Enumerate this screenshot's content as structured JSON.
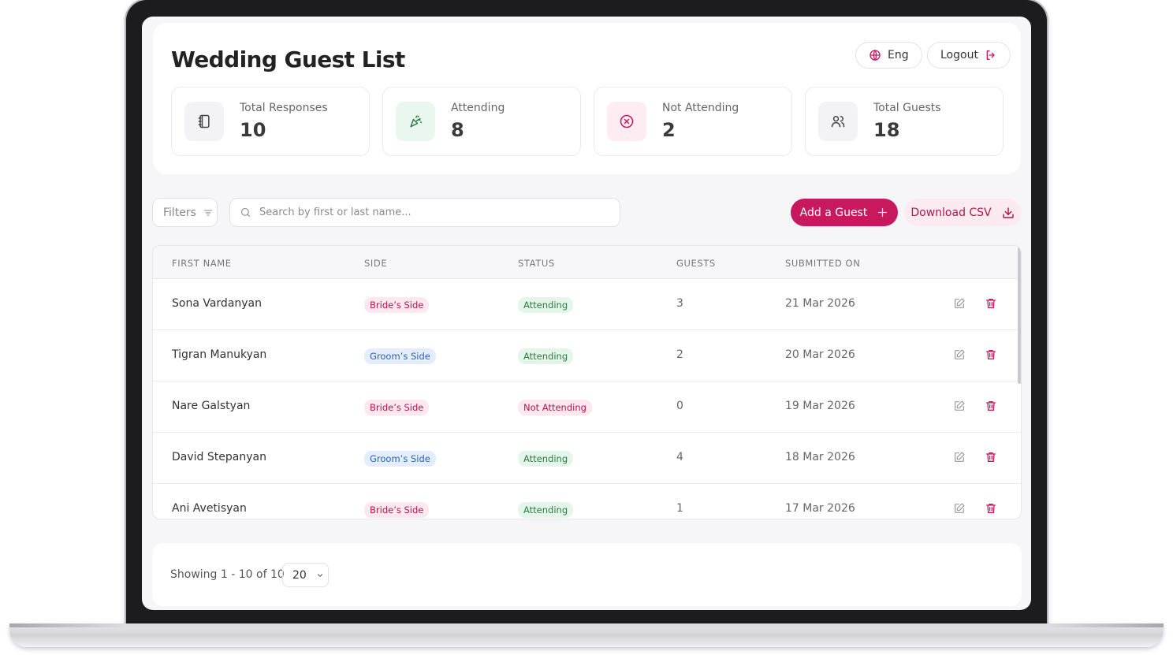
{
  "app": {
    "title": "Wedding Guest List",
    "lang_label": "Eng",
    "logout_label": "Logout"
  },
  "stats": [
    {
      "label": "Total Responses",
      "value": "10",
      "icon": "notebook-icon",
      "bg": "#f3f3f5",
      "color": "#444444"
    },
    {
      "label": "Attending",
      "value": "8",
      "icon": "party-popper-icon",
      "bg": "#eaf7ee",
      "color": "#2f7a45"
    },
    {
      "label": "Not Attending",
      "value": "2",
      "icon": "x-circle-icon",
      "bg": "#fdecf1",
      "color": "#c8185e"
    },
    {
      "label": "Total Guests",
      "value": "18",
      "icon": "users-icon",
      "bg": "#f3f3f5",
      "color": "#444444"
    }
  ],
  "toolbar": {
    "filters_label": "Filters",
    "search_placeholder": "Search by first or last name...",
    "add_label": "Add a Guest",
    "csv_label": "Download CSV"
  },
  "table": {
    "headers": [
      "FIRST NAME",
      "SIDE",
      "STATUS",
      "GUESTS",
      "SUBMITTED ON"
    ],
    "rows": [
      {
        "name": "Sona Vardanyan",
        "side": "Bride’s Side",
        "side_type": "bride",
        "status": "Attending",
        "status_type": "att",
        "guests": "3",
        "date": "21 Mar 2026"
      },
      {
        "name": "Tigran Manukyan",
        "side": "Groom’s Side",
        "side_type": "groom",
        "status": "Attending",
        "status_type": "att",
        "guests": "2",
        "date": "20 Mar 2026"
      },
      {
        "name": "Nare Galstyan",
        "side": "Bride’s Side",
        "side_type": "bride",
        "status": "Not Attending",
        "status_type": "not",
        "guests": "0",
        "date": "19 Mar 2026"
      },
      {
        "name": "David Stepanyan",
        "side": "Groom’s Side",
        "side_type": "groom",
        "status": "Attending",
        "status_type": "att",
        "guests": "4",
        "date": "18 Mar 2026"
      },
      {
        "name": "Ani Avetisyan",
        "side": "Bride’s Side",
        "side_type": "bride",
        "status": "Attending",
        "status_type": "att",
        "guests": "1",
        "date": "17 Mar 2026"
      }
    ]
  },
  "footer": {
    "showing_label": "Showing 1 - 10 of 10",
    "page_size": "20"
  },
  "colors": {
    "accent": "#c8185e",
    "accent_soft": "#fbeaf0"
  }
}
